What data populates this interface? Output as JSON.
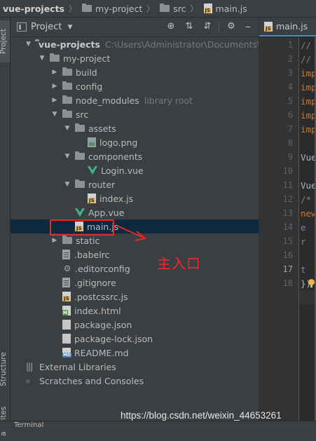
{
  "breadcrumb": [
    "vue-projects",
    "my-project",
    "src",
    "main.js"
  ],
  "toolstrip": {
    "project_tab": "Project",
    "structure_tab": "Structure",
    "favorites_tab": "avorites"
  },
  "panel": {
    "title": "Project",
    "title_dropdown": "▼"
  },
  "tree": [
    {
      "indent": 0,
      "arrow": "▼",
      "icon": "folder",
      "label": "vue-projects",
      "bold": true,
      "hint": "C:\\Users\\Administrator\\Documents\\vue-"
    },
    {
      "indent": 1,
      "arrow": "▼",
      "icon": "folder",
      "label": "my-project"
    },
    {
      "indent": 2,
      "arrow": "▶",
      "icon": "folder",
      "label": "build"
    },
    {
      "indent": 2,
      "arrow": "▶",
      "icon": "folder",
      "label": "config"
    },
    {
      "indent": 2,
      "arrow": "▶",
      "icon": "folder",
      "label": "node_modules",
      "hint": "library root"
    },
    {
      "indent": 2,
      "arrow": "▼",
      "icon": "folder",
      "label": "src"
    },
    {
      "indent": 3,
      "arrow": "▼",
      "icon": "folder",
      "label": "assets"
    },
    {
      "indent": 4,
      "arrow": "",
      "icon": "png",
      "label": "logo.png"
    },
    {
      "indent": 3,
      "arrow": "▼",
      "icon": "folder",
      "label": "components"
    },
    {
      "indent": 4,
      "arrow": "",
      "icon": "vue",
      "label": "Login.vue"
    },
    {
      "indent": 3,
      "arrow": "▼",
      "icon": "folder",
      "label": "router"
    },
    {
      "indent": 4,
      "arrow": "",
      "icon": "js",
      "label": "index.js"
    },
    {
      "indent": 3,
      "arrow": "",
      "icon": "vue",
      "label": "App.vue"
    },
    {
      "indent": 3,
      "arrow": "",
      "icon": "js",
      "label": "main.js",
      "selected": true
    },
    {
      "indent": 2,
      "arrow": "▶",
      "icon": "folder",
      "label": "static"
    },
    {
      "indent": 2,
      "arrow": "",
      "icon": "txt",
      "label": ".babelrc"
    },
    {
      "indent": 2,
      "arrow": "",
      "icon": "gear",
      "label": ".editorconfig"
    },
    {
      "indent": 2,
      "arrow": "",
      "icon": "txt",
      "label": ".gitignore"
    },
    {
      "indent": 2,
      "arrow": "",
      "icon": "js",
      "label": ".postcssrc.js"
    },
    {
      "indent": 2,
      "arrow": "",
      "icon": "html",
      "label": "index.html"
    },
    {
      "indent": 2,
      "arrow": "",
      "icon": "json",
      "label": "package.json"
    },
    {
      "indent": 2,
      "arrow": "",
      "icon": "json",
      "label": "package-lock.json"
    },
    {
      "indent": 2,
      "arrow": "",
      "icon": "md",
      "label": "README.md"
    },
    {
      "indent": 0,
      "arrow": "",
      "icon": "library",
      "label": "External Libraries"
    },
    {
      "indent": 0,
      "arrow": "",
      "icon": "scratches",
      "label": "Scratches and Consoles"
    }
  ],
  "annotation": {
    "label": "主入口",
    "color": "#ec2b2b"
  },
  "editor": {
    "tab_label": "main.js",
    "current_line": "17",
    "lines": [
      {
        "n": "1",
        "text": "//",
        "color": "#808080"
      },
      {
        "n": "2",
        "text": "//",
        "color": "#808080"
      },
      {
        "n": "3",
        "text": "imp",
        "color": "#cc7832"
      },
      {
        "n": "4",
        "text": "imp",
        "color": "#cc7832"
      },
      {
        "n": "5",
        "text": "imp",
        "color": "#cc7832"
      },
      {
        "n": "6",
        "text": "imp",
        "color": "#cc7832"
      },
      {
        "n": "7",
        "text": "imp",
        "color": "#cc7832"
      },
      {
        "n": "8",
        "text": "",
        "color": "#a9b7c6"
      },
      {
        "n": "9",
        "text": "Vue",
        "color": "#a9b7c6"
      },
      {
        "n": "10",
        "text": "",
        "color": "#a9b7c6"
      },
      {
        "n": "11",
        "text": "Vue",
        "color": "#a9b7c6"
      },
      {
        "n": "12",
        "text": "/*",
        "color": "#808080"
      },
      {
        "n": "13",
        "text": "new",
        "color": "#cc7832"
      },
      {
        "n": "14",
        "text": "  e",
        "color": "#9876aa"
      },
      {
        "n": "15",
        "text": "  r",
        "color": "#9876aa"
      },
      {
        "n": "16",
        "text": "",
        "color": "#a9b7c6"
      },
      {
        "n": "17",
        "text": "  t",
        "color": "#9876aa"
      },
      {
        "n": "18",
        "text": "})",
        "color": "#a9b7c6"
      }
    ]
  },
  "bottom": {
    "label": "Terminal"
  },
  "watermark": "https://blog.csdn.net/weixin_44653261"
}
